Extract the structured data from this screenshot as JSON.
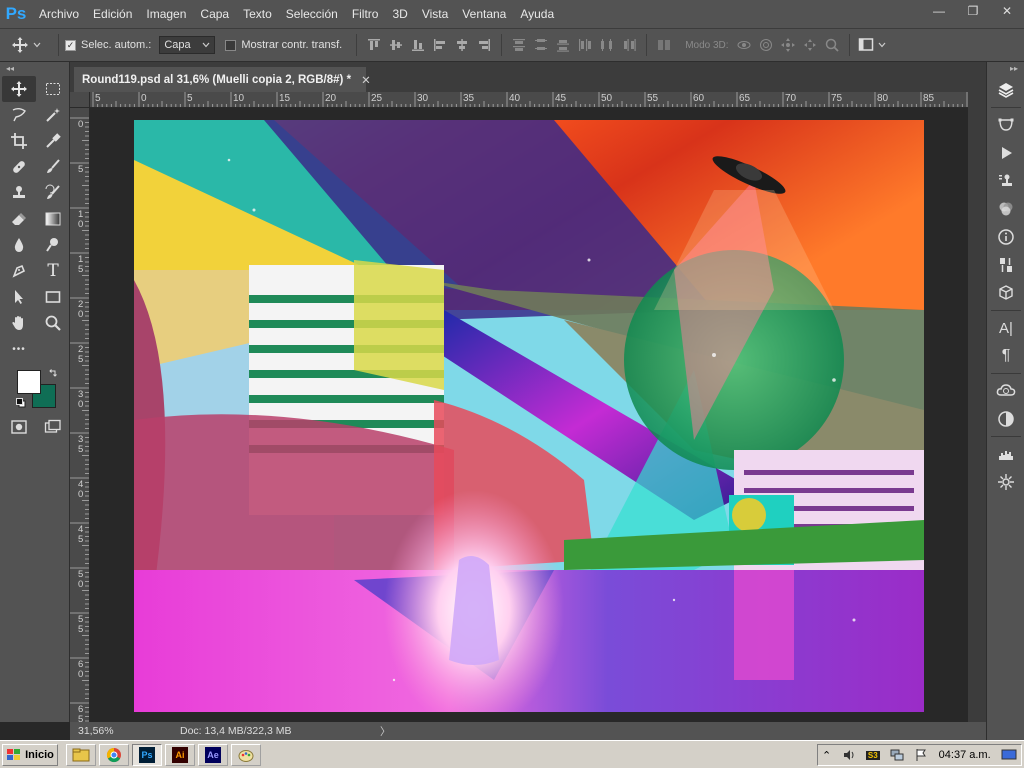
{
  "app": {
    "logo": "Ps",
    "menu": [
      "Archivo",
      "Edición",
      "Imagen",
      "Capa",
      "Texto",
      "Selección",
      "Filtro",
      "3D",
      "Vista",
      "Ventana",
      "Ayuda"
    ]
  },
  "window_controls": {
    "minimize": "—",
    "restore": "❐",
    "close": "✕"
  },
  "options": {
    "auto_select_label": "Selec. autom.:",
    "auto_select_checked": true,
    "target_value": "Capa",
    "show_transform_label": "Mostrar contr. transf.",
    "show_transform_checked": false,
    "mode_3d_label": "Modo 3D:"
  },
  "document": {
    "tab_title": "Round119.psd al 31,6% (Muelli copia 2, RGB/8#) *",
    "tab_close": "✕",
    "ruler_h_labels": [
      "5",
      "0",
      "5",
      "10",
      "15",
      "20",
      "25",
      "30",
      "35",
      "40",
      "45",
      "50",
      "55",
      "60",
      "65",
      "70",
      "75",
      "80",
      "85",
      "90"
    ],
    "ruler_v_labels": [
      "0",
      "5",
      "1\n0",
      "1\n5",
      "2\n0",
      "2\n5",
      "3\n0",
      "3\n5",
      "4\n0",
      "4\n5",
      "5\n0",
      "5\n5",
      "6\n0",
      "6\n5"
    ]
  },
  "status": {
    "zoom": "31,56%",
    "doc_info": "Doc: 13,4 MB/322,3 MB",
    "arrow": "〉"
  },
  "colors": {
    "foreground": "#ffffff",
    "background": "#0f6e55",
    "ui_panel": "#535353",
    "ui_dark": "#282828"
  },
  "tools": [
    "move-icon",
    "marquee-icon",
    "lasso-icon",
    "magic-wand-icon",
    "crop-icon",
    "eyedropper-icon",
    "healing-icon",
    "brush-icon",
    "stamp-icon",
    "history-brush-icon",
    "eraser-icon",
    "gradient-icon",
    "blur-icon",
    "dodge-icon",
    "pen-icon",
    "type-icon",
    "path-select-icon",
    "rectangle-icon",
    "hand-icon",
    "zoom-icon"
  ],
  "type_tool_glyph": "T",
  "more_tools_glyph": "•••",
  "panels": [
    "layers-icon",
    "paths-icon",
    "actions-icon",
    "clone-source-icon",
    "color-icon",
    "info-icon",
    "adjustments-icon",
    "3d-icon",
    "character-icon",
    "paragraph-icon",
    "libraries-icon",
    "styles-icon",
    "histogram-icon",
    "navigator-icon"
  ],
  "panel_glyphs": {
    "character": "A|",
    "paragraph": "¶"
  },
  "collapse_glyph": "◂◂",
  "collapse_glyph_right": "▸▸",
  "taskbar": {
    "start_label": "Inicio",
    "apps": [
      "file-explorer-icon",
      "chrome-icon",
      "photoshop-icon",
      "illustrator-icon",
      "after-effects-icon",
      "paint-icon"
    ],
    "app_labels": {
      "photoshop": "Ps",
      "illustrator": "Ai",
      "after_effects": "Ae"
    },
    "clock": "04:37 a.m.",
    "tray_up": "⌃",
    "tray_badge": "S3"
  }
}
